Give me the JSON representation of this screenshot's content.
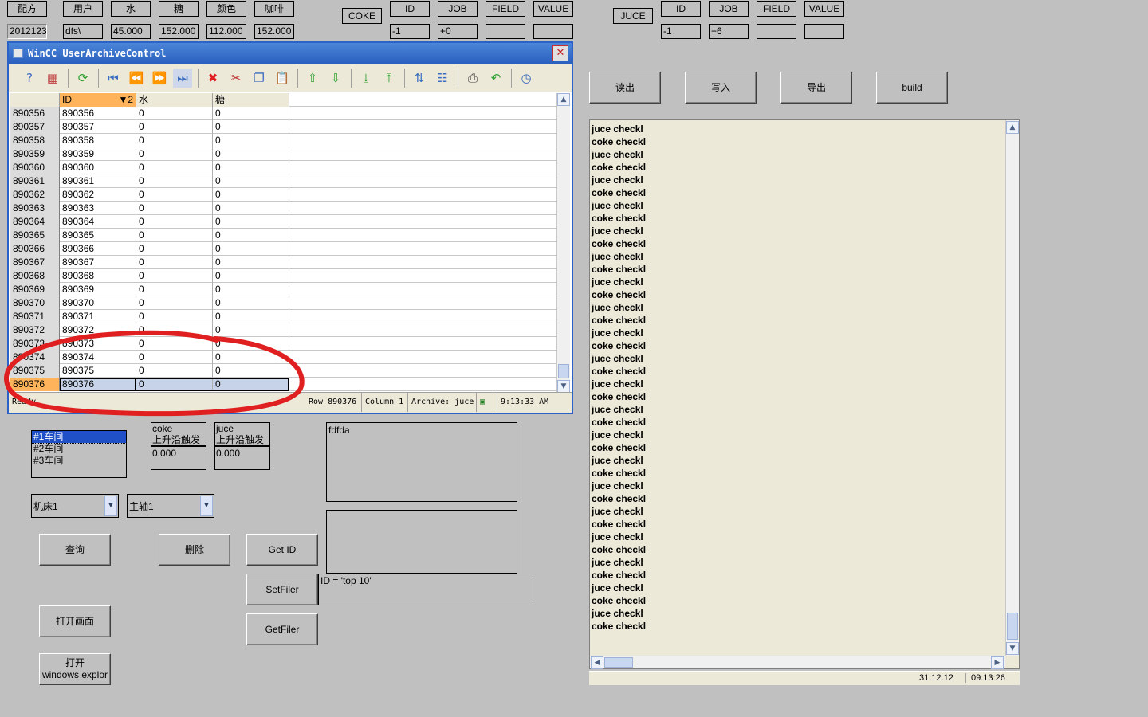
{
  "top_header": {
    "cols": [
      "配方",
      "用户",
      "水",
      "糖",
      "颜色",
      "咖啡"
    ],
    "values": [
      "2012123",
      "dfs\\",
      "45.000",
      "152.000",
      "112.000",
      "152.000"
    ]
  },
  "coke_group": {
    "label": "COKE",
    "cols": [
      "ID",
      "JOB",
      "FIELD",
      "VALUE"
    ],
    "values": [
      "-1",
      "+0",
      "",
      ""
    ]
  },
  "juce_group": {
    "label": "JUCE",
    "cols": [
      "ID",
      "JOB",
      "FIELD",
      "VALUE"
    ],
    "values": [
      "-1",
      "+6",
      "",
      ""
    ]
  },
  "window": {
    "title": "WinCC UserArchiveControl",
    "close_glyph": "✕",
    "toolbar_icons": [
      "help-icon",
      "config-icon",
      "refresh-icon",
      "first-record-icon",
      "prev-record-icon",
      "next-record-icon",
      "last-record-icon",
      "delete-icon",
      "cut-icon",
      "copy-icon",
      "paste-icon",
      "import-icon",
      "export-icon",
      "read-tags-icon",
      "write-tags-icon",
      "sort-icon",
      "select-icon",
      "print-icon",
      "undo-icon",
      "timer-icon"
    ],
    "grid": {
      "headers": [
        "",
        "ID",
        "水",
        "糖"
      ],
      "sort_marker": "▼2",
      "rows": [
        [
          "890356",
          "890356",
          "0",
          "0"
        ],
        [
          "890357",
          "890357",
          "0",
          "0"
        ],
        [
          "890358",
          "890358",
          "0",
          "0"
        ],
        [
          "890359",
          "890359",
          "0",
          "0"
        ],
        [
          "890360",
          "890360",
          "0",
          "0"
        ],
        [
          "890361",
          "890361",
          "0",
          "0"
        ],
        [
          "890362",
          "890362",
          "0",
          "0"
        ],
        [
          "890363",
          "890363",
          "0",
          "0"
        ],
        [
          "890364",
          "890364",
          "0",
          "0"
        ],
        [
          "890365",
          "890365",
          "0",
          "0"
        ],
        [
          "890366",
          "890366",
          "0",
          "0"
        ],
        [
          "890367",
          "890367",
          "0",
          "0"
        ],
        [
          "890368",
          "890368",
          "0",
          "0"
        ],
        [
          "890369",
          "890369",
          "0",
          "0"
        ],
        [
          "890370",
          "890370",
          "0",
          "0"
        ],
        [
          "890371",
          "890371",
          "0",
          "0"
        ],
        [
          "890372",
          "890372",
          "0",
          "0"
        ],
        [
          "890373",
          "890373",
          "0",
          "0"
        ],
        [
          "890374",
          "890374",
          "0",
          "0"
        ],
        [
          "890375",
          "890375",
          "0",
          "0"
        ],
        [
          "890376",
          "890376",
          "0",
          "0"
        ]
      ],
      "selected_index": 20
    },
    "status": {
      "ready": "Ready",
      "row": "Row 890376",
      "column": "Column 1",
      "archive": "Archive: juce",
      "time": "9:13:33 AM"
    }
  },
  "listbox": {
    "items": [
      "#1车间",
      "#2车间",
      "#3车间"
    ],
    "selected_index": 0
  },
  "coke_box": {
    "name": "coke",
    "label": "上升沿触发",
    "value": "0.000"
  },
  "juce_box": {
    "name": "juce",
    "label": "上升沿触发",
    "value": "0.000"
  },
  "textbox1": "fdfda",
  "textbox2": "",
  "filter_text": "ID = 'top 10'",
  "combo1": "机床1",
  "combo2": "主轴1",
  "buttons": {
    "query": "查询",
    "delete": "删除",
    "get_id": "Get ID",
    "set_filter": "SetFiler",
    "get_filter": "GetFiler",
    "open_screen": "打开画面",
    "open_explorer_1": "打开",
    "open_explorer_2": "windows explor",
    "read": "读出",
    "write": "写入",
    "export": "导出",
    "build": "build"
  },
  "log": {
    "lines": [
      "juce checkl",
      "coke checkl",
      "juce checkl",
      "coke checkl",
      "juce checkl",
      "coke checkl",
      "juce checkl",
      "coke checkl",
      "juce checkl",
      "coke checkl",
      "juce checkl",
      "coke checkl",
      "juce checkl",
      "coke checkl",
      "juce checkl",
      "coke checkl",
      "juce checkl",
      "coke checkl",
      "juce checkl",
      "coke checkl",
      "juce checkl",
      "coke checkl",
      "juce checkl",
      "coke checkl",
      "juce checkl",
      "coke checkl",
      "juce checkl",
      "coke checkl",
      "juce checkl",
      "coke checkl",
      "juce checkl",
      "coke checkl",
      "juce checkl",
      "coke checkl",
      "juce checkl",
      "coke checkl",
      "juce checkl",
      "coke checkl",
      "juce checkl",
      "coke checkl"
    ]
  },
  "footer": {
    "date": "31.12.12",
    "time": "09:13:26"
  },
  "colors": {
    "highlight_circle": "#e02020",
    "selected_row": "#c7d3e8",
    "sort_header": "#ffb35a",
    "title_bar": "#2a5fbf"
  }
}
